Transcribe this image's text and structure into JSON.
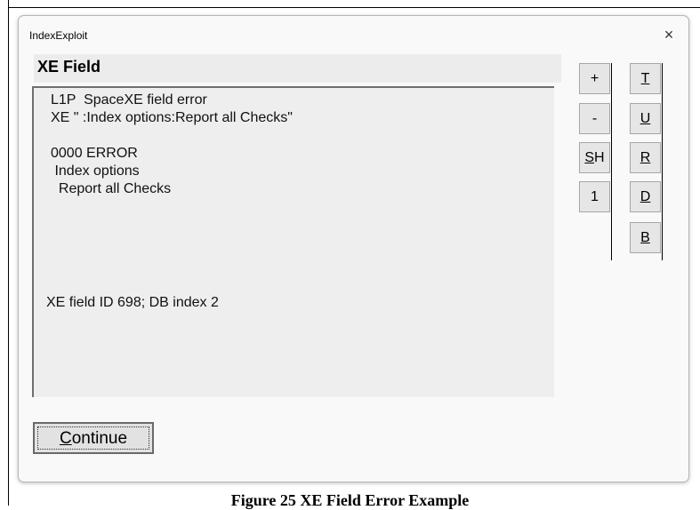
{
  "window": {
    "title": "IndexExploit",
    "close_glyph": "×"
  },
  "field_title": "XE Field",
  "message_lines": [
    "L1P  SpaceXE field error",
    "XE \" :Index options:Report all Checks\"",
    "0000 ERROR",
    " Index options",
    "  Report all Checks",
    "XE field ID 698; DB index 2"
  ],
  "left_buttons": [
    {
      "label": "+",
      "name": "plus-button"
    },
    {
      "label": "-",
      "name": "minus-button"
    },
    {
      "label": "SH",
      "accel": "S",
      "rest": "H",
      "name": "sh-button"
    },
    {
      "label": "1",
      "name": "one-button"
    }
  ],
  "right_buttons": [
    {
      "label": "T",
      "name": "t-button"
    },
    {
      "label": "U",
      "name": "u-button"
    },
    {
      "label": "R",
      "name": "r-button"
    },
    {
      "label": "D",
      "name": "d-button"
    },
    {
      "label": "B",
      "name": "b-button"
    }
  ],
  "continue": {
    "accel": "C",
    "rest": "ontinue"
  },
  "caption": "Figure 25 XE Field Error Example"
}
